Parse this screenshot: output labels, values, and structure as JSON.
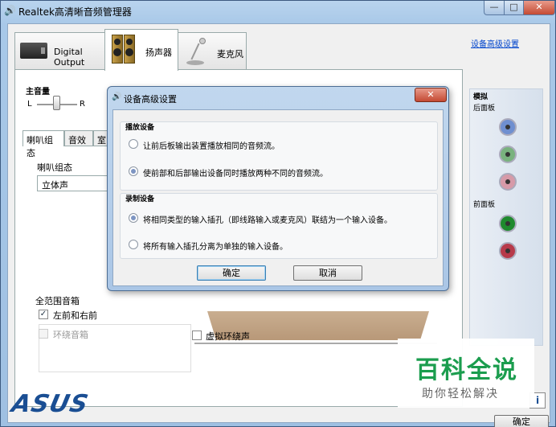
{
  "window": {
    "title": "Realtek高清晰音频管理器",
    "minimize": "—",
    "maximize": "□",
    "close": "✕"
  },
  "tabs": [
    {
      "label": "Digital Output"
    },
    {
      "label": "扬声器"
    },
    {
      "label": "麦克风"
    }
  ],
  "right_panel": {
    "advanced_link": "设备高级设置",
    "analog_label": "模拟",
    "rear_label": "后面板",
    "front_label": "前面板",
    "jack_colors": {
      "rear_blue": "#6f8fd0",
      "rear_green": "#79b27e",
      "rear_pink": "#d69aa8",
      "front_green": "#1f8a2e",
      "front_red": "#b73a4a"
    }
  },
  "main": {
    "volume_label": "主音量",
    "left": "L",
    "right": "R",
    "subtabs": [
      "喇叭组态",
      "音效",
      "室"
    ],
    "speaker_config_label": "喇叭组态",
    "speaker_config_value": "立体声",
    "full_range_title": "全范围音箱",
    "front_lr_label": "左前和右前",
    "surround_label": "环绕音箱",
    "virtual_surround_label": "虚拟环绕声"
  },
  "footer": {
    "brand": "ASUS",
    "info": "i",
    "ok_label": "确定"
  },
  "watermark": {
    "main": "百科全说",
    "sub": "助你轻松解决"
  },
  "dialog": {
    "title": "设备高级设置",
    "close": "✕",
    "playback_group": "播放设备",
    "playback_opt1": "让前后板输出装置播放相同的音频流。",
    "playback_opt2": "使前部和后部输出设备同时播放两种不同的音频流。",
    "record_group": "录制设备",
    "record_opt1": "将相同类型的输入插孔（即线路输入或麦克风）联结为一个输入设备。",
    "record_opt2": "将所有输入插孔分离为单独的输入设备。",
    "ok": "确定",
    "cancel": "取消"
  }
}
